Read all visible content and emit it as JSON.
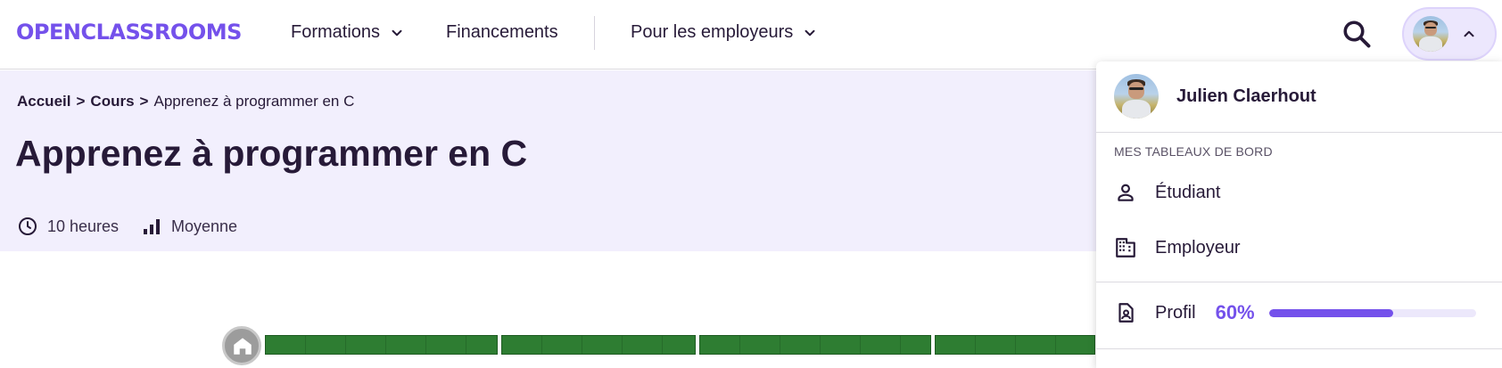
{
  "brand": {
    "logo_text": "OPENCLASSROOMS",
    "color": "#7451eb"
  },
  "nav": {
    "formations": "Formations",
    "financements": "Financements",
    "employeurs": "Pour les employeurs"
  },
  "icons": {
    "search": "search-icon",
    "chevron": "chevron-down-icon",
    "chevron_up": "chevron-up-icon",
    "clock": "clock-icon",
    "level": "bar-chart-icon",
    "person": "person-icon",
    "building": "building-icon",
    "profile": "profile-card-icon",
    "home": "home-icon"
  },
  "breadcrumb": {
    "home": "Accueil",
    "sep": ">",
    "courses": "Cours",
    "current": "Apprenez à programmer en C"
  },
  "course": {
    "title": "Apprenez à programmer en C",
    "duration": "10 heures",
    "level": "Moyenne"
  },
  "user_menu": {
    "name": "Julien Claerhout",
    "section_title": "MES TABLEAUX DE BORD",
    "student": "Étudiant",
    "employer": "Employeur",
    "profile": "Profil",
    "profile_completion_label": "60%",
    "profile_completion": 0.6
  },
  "colors": {
    "accent": "#7451eb",
    "hero_bg": "#f2effd",
    "progress_green": "#2e7d32"
  }
}
